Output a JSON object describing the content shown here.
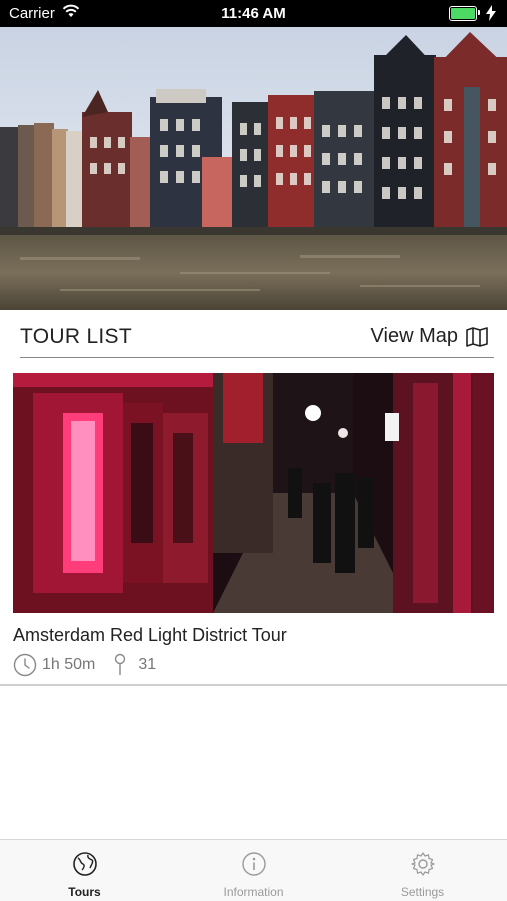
{
  "status_bar": {
    "carrier": "Carrier",
    "time": "11:46 AM"
  },
  "section": {
    "title": "TOUR LIST",
    "view_map_label": "View Map"
  },
  "tours": [
    {
      "title": "Amsterdam Red Light District Tour",
      "duration": "1h 50m",
      "stops": "31"
    }
  ],
  "tab_bar": {
    "tabs": [
      {
        "label": "Tours",
        "icon": "globe-icon",
        "active": true
      },
      {
        "label": "Information",
        "icon": "info-icon",
        "active": false
      },
      {
        "label": "Settings",
        "icon": "gear-icon",
        "active": false
      }
    ]
  },
  "colors": {
    "accent_active": "#222222",
    "inactive": "#9a9a9a",
    "battery": "#4cd964"
  }
}
